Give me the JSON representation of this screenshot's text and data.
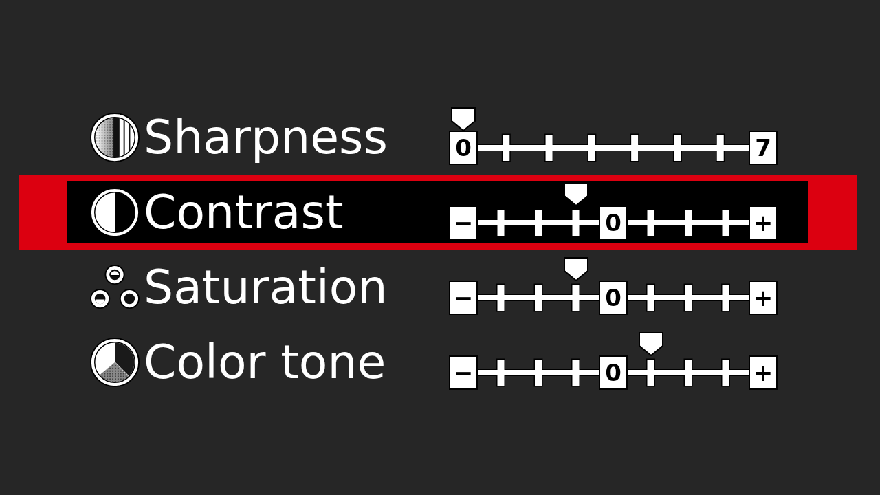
{
  "rows": [
    {
      "label": "Sharpness",
      "selected": false,
      "scale": {
        "kind": "unipolar",
        "min_label": "0",
        "max_label": "7",
        "level": 0
      }
    },
    {
      "label": "Contrast",
      "selected": true,
      "scale": {
        "kind": "bipolar",
        "min_label": "−",
        "center_label": "0",
        "max_label": "+",
        "level": 0.375
      }
    },
    {
      "label": "Saturation",
      "selected": false,
      "scale": {
        "kind": "bipolar",
        "min_label": "−",
        "center_label": "0",
        "max_label": "+",
        "level": 0.375
      }
    },
    {
      "label": "Color tone",
      "selected": false,
      "scale": {
        "kind": "bipolar",
        "min_label": "−",
        "center_label": "0",
        "max_label": "+",
        "level": 0.625
      }
    }
  ]
}
